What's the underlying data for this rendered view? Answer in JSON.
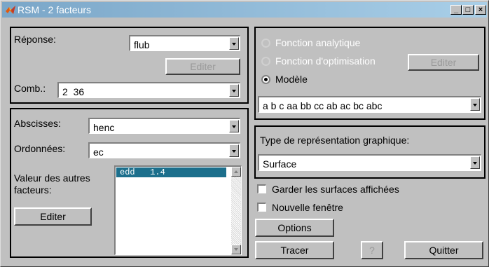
{
  "window": {
    "title": "RSM - 2 facteurs",
    "title_bar_gradient": [
      "#7aa6c8",
      "#a9cfe8"
    ],
    "minimize_glyph": "_",
    "maximize_glyph": "□",
    "close_glyph": "×"
  },
  "response_panel": {
    "reponse_label": "Réponse:",
    "reponse_value": "flub",
    "edit_button": "Editer",
    "comb_label": "Comb.:",
    "comb_value": "2  36"
  },
  "axes_panel": {
    "abscisses_label": "Abscisses:",
    "abscisses_value": "henc",
    "ordonnees_label": "Ordonnées:",
    "ordonnees_value": "ec",
    "other_factors_label_1": "Valeur des autres",
    "other_factors_label_2": "facteurs:",
    "edit_button": "Editer",
    "factor_list": [
      "edd   1.4"
    ]
  },
  "model_panel": {
    "radio_analytic": "Fonction analytique",
    "radio_optimisation": "Fonction d'optimisation",
    "radio_model": "Modèle",
    "selected": "Modèle",
    "edit_button": "Editer",
    "model_value": "a b c aa bb cc ab ac bc abc"
  },
  "graph_panel": {
    "type_label": "Type de représentation graphique:",
    "type_value": "Surface"
  },
  "options": {
    "keep_surfaces_label": "Garder les surfaces affichées",
    "keep_surfaces_checked": false,
    "new_window_label": "Nouvelle fenêtre",
    "new_window_checked": false,
    "options_button": "Options",
    "plot_button": "Tracer",
    "help_button": "?",
    "quit_button": "Quitter"
  }
}
